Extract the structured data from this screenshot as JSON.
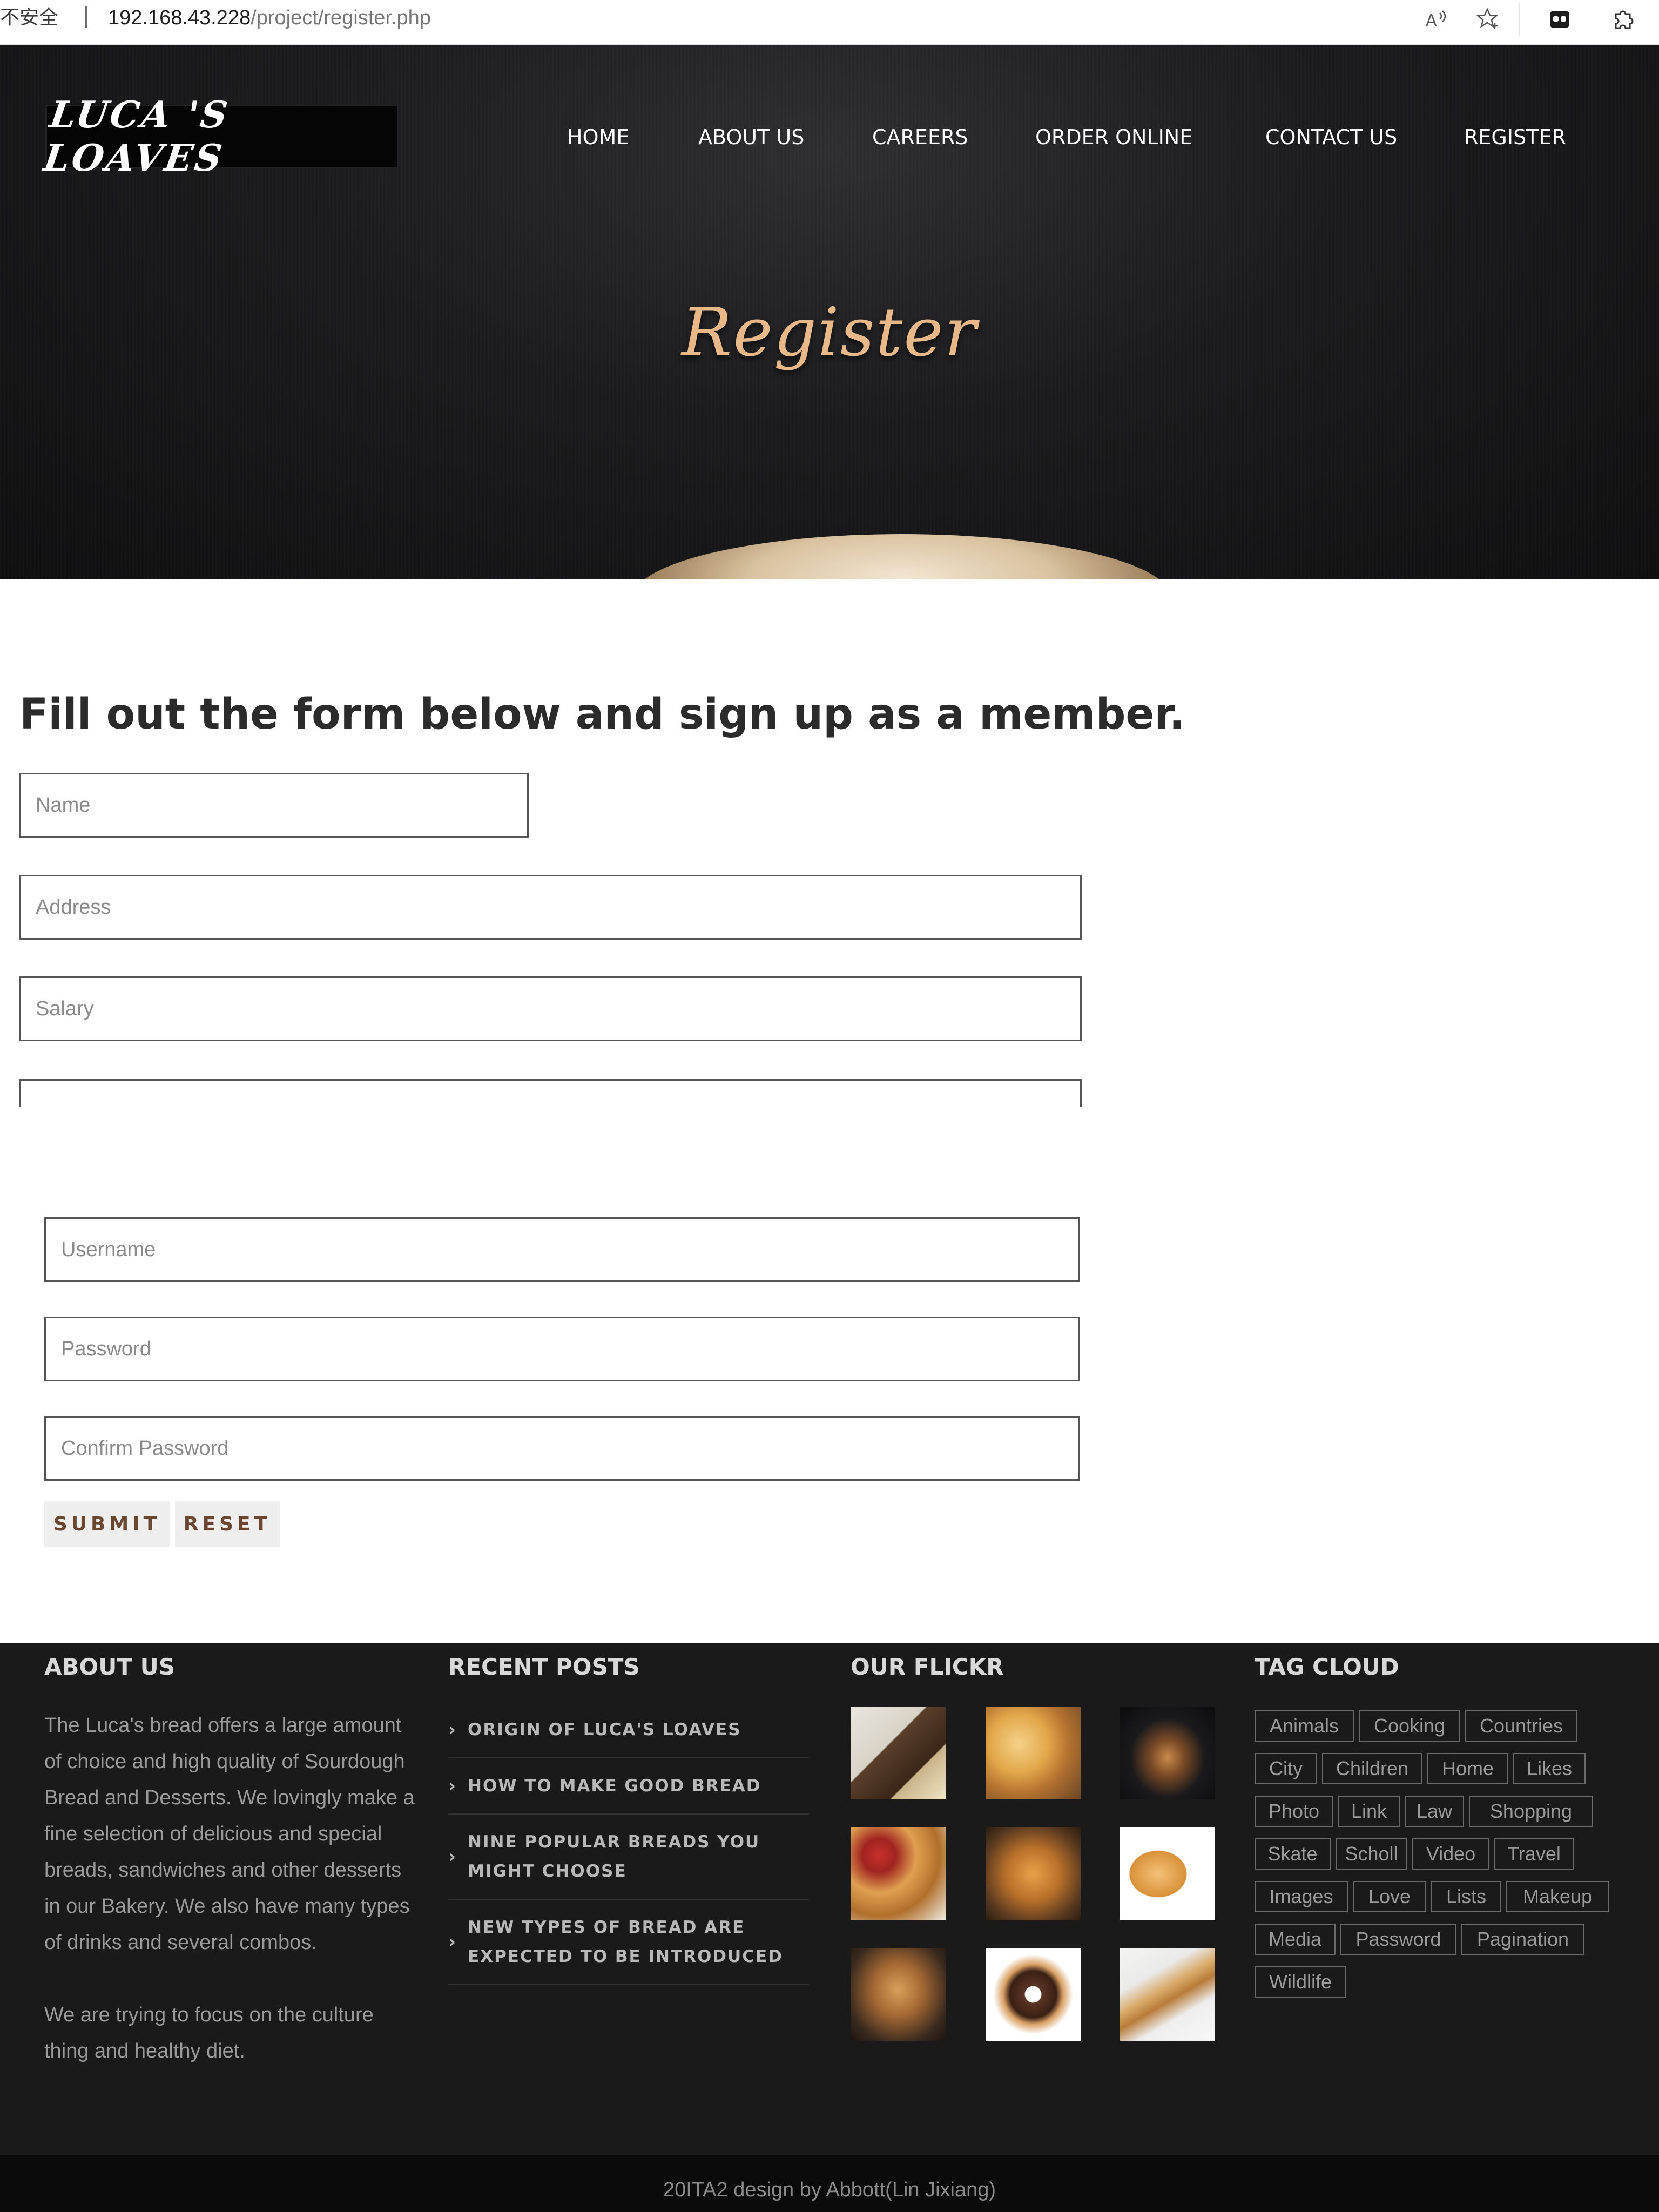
{
  "browser": {
    "insecure_label": "不安全",
    "url_host": "192.168.43.228",
    "url_path": "/project/register.php",
    "icons": [
      "read-aloud-icon",
      "favorite-star-icon",
      "extension-icon",
      "puzzle-icon"
    ]
  },
  "header": {
    "logo_text": "LUCA 'S LOAVES",
    "nav": [
      "HOME",
      "ABOUT US",
      "CAREERS",
      "ORDER ONLINE",
      "CONTACT US",
      "REGISTER"
    ],
    "page_title": "Register"
  },
  "form": {
    "heading": "Fill out the form below and sign up as a member.",
    "name_placeholder": "Name",
    "address_placeholder": "Address",
    "salary_placeholder": "Salary",
    "clipped_placeholder": ". .",
    "username_placeholder": "Username",
    "password_placeholder": "Password",
    "confirm_placeholder": "Confirm Password",
    "submit_label": "SUBMIT",
    "reset_label": "RESET"
  },
  "footer": {
    "about": {
      "title": "ABOUT US",
      "paragraph1": "The Luca's bread offers a large amount of choice and high quality of Sourdough Bread and Desserts. We lovingly make a fine selection of delicious and special breads, sandwiches and other desserts in our Bakery. We also have many types of drinks and several combos.",
      "paragraph2": "We are trying to focus on the culture thing and healthy diet."
    },
    "recent_posts": {
      "title": "RECENT POSTS",
      "items": [
        "ORIGIN OF LUCA'S LOAVES",
        "HOW TO MAKE GOOD BREAD",
        "NINE POPULAR BREADS YOU MIGHT CHOOSE",
        "NEW TYPES OF BREAD ARE EXPECTED TO BE INTRODUCED"
      ]
    },
    "flickr": {
      "title": "OUR FLICKR",
      "thumbs": [
        "bread-slices-photo",
        "croissants-photo",
        "dark-croissant-photo",
        "croissants-tomato-photo",
        "bundt-loaf-photo",
        "bread-rolls-photo",
        "rustic-buns-photo",
        "donut-photo",
        "baguette-photo"
      ]
    },
    "tag_cloud": {
      "title": "TAG CLOUD",
      "tags": [
        "Animals",
        "Cooking",
        "Countries",
        "City",
        "Children",
        "Home",
        "Likes",
        "Photo",
        "Link",
        "Law",
        "Shopping",
        "Skate",
        "Scholl",
        "Video",
        "Travel",
        "Images",
        "Love",
        "Lists",
        "Makeup",
        "Media",
        "Password",
        "Pagination",
        "Wildlife"
      ]
    },
    "copyright": "20ITA2 design by Abbott(Lin Jixiang)"
  },
  "colors": {
    "hero_title": "#e8b888",
    "button_text": "#6a4630",
    "footer_bg": "#1a1a1a"
  }
}
